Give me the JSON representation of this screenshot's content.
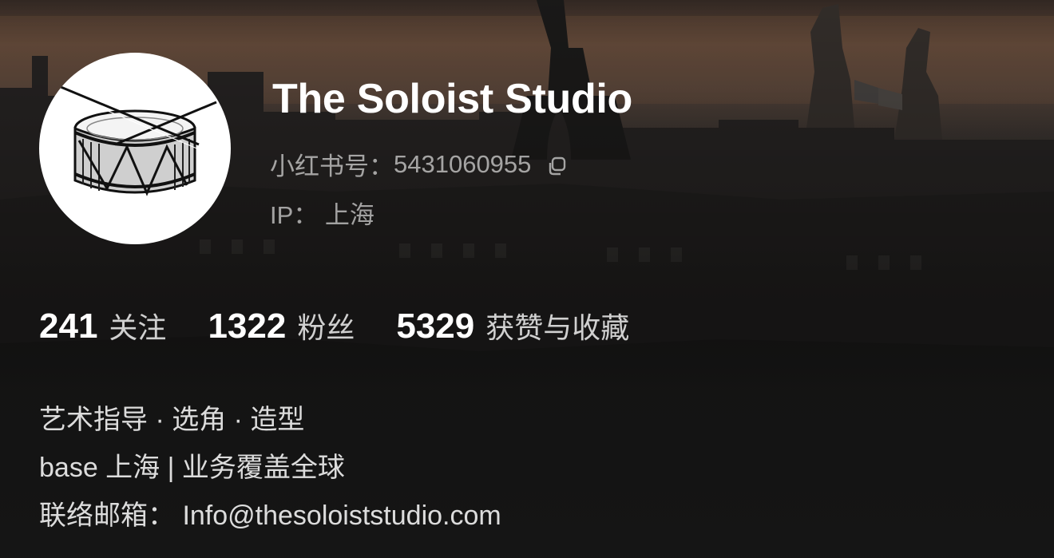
{
  "profile": {
    "name": "The Soloist Studio",
    "id_label": "小红书号：",
    "id_value": "5431060955",
    "ip_label": "IP：",
    "ip_value": "上海"
  },
  "stats": [
    {
      "value": "241",
      "label": "关注"
    },
    {
      "value": "1322",
      "label": "粉丝"
    },
    {
      "value": "5329",
      "label": "获赞与收藏"
    }
  ],
  "bio": {
    "line1": "艺术指导 · 选角 · 造型",
    "line2": "base 上海 | 业务覆盖全球",
    "line3": "联络邮箱： Info@thesoloiststudio.com"
  },
  "icons": {
    "copy": "copy-icon",
    "avatar": "snare-drum-icon"
  },
  "colors": {
    "text_primary": "#ffffff",
    "text_secondary": "#a8a8a8",
    "background": "#141414"
  }
}
